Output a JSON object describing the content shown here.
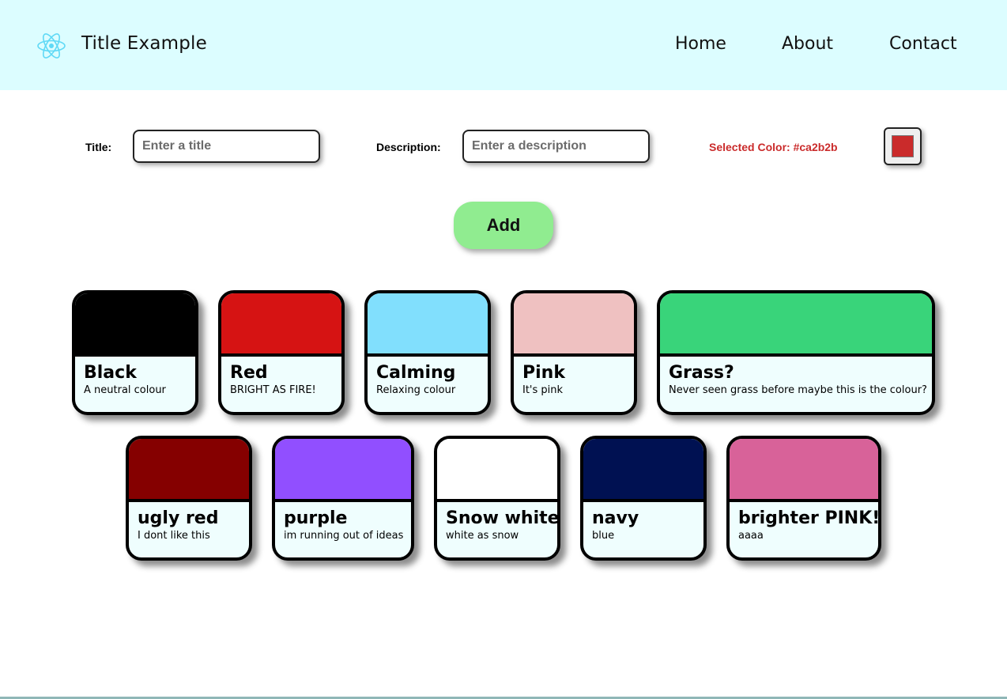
{
  "header": {
    "title": "Title Example",
    "nav": [
      "Home",
      "About",
      "Contact"
    ]
  },
  "form": {
    "title_label": "Title:",
    "title_placeholder": "Enter a title",
    "title_value": "",
    "description_label": "Description:",
    "description_placeholder": "Enter a description",
    "description_value": "",
    "selected_color_text": "Selected Color: #ca2b2b",
    "selected_color": "#ca2b2b",
    "add_label": "Add"
  },
  "colors": {
    "logo": "#5fd9f6",
    "navbar_bg": "#dcfdff",
    "add_button": "#90ec90"
  },
  "cards": [
    {
      "title": "Black",
      "description": "A neutral colour",
      "color": "#000000"
    },
    {
      "title": "Red",
      "description": "BRIGHT AS FIRE!",
      "color": "#d61313"
    },
    {
      "title": "Calming",
      "description": "Relaxing colour",
      "color": "#81dffd"
    },
    {
      "title": "Pink",
      "description": "It's pink",
      "color": "#efc1c1"
    },
    {
      "title": "Grass?",
      "description": "Never seen grass before maybe this is the colour?",
      "color": "#39d47a"
    },
    {
      "title": "ugly red",
      "description": "I dont like this",
      "color": "#850000"
    },
    {
      "title": "purple",
      "description": "im running out of ideas",
      "color": "#914fff"
    },
    {
      "title": "Snow white",
      "description": "white as snow",
      "color": "#ffffff"
    },
    {
      "title": "navy",
      "description": "blue",
      "color": "#001152"
    },
    {
      "title": "brighter PINK!",
      "description": "aaaa",
      "color": "#d86299"
    }
  ]
}
